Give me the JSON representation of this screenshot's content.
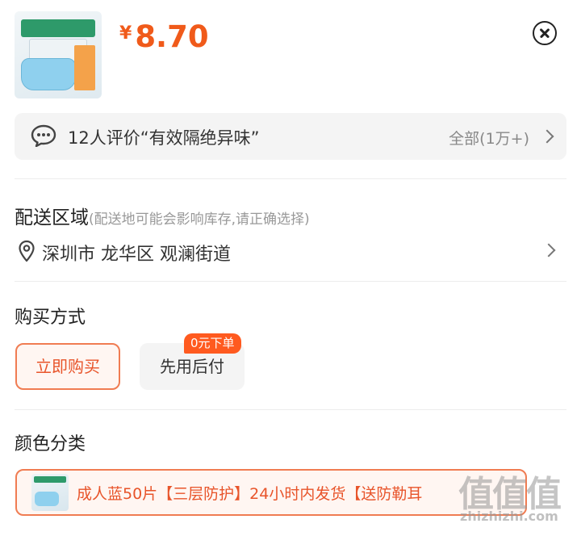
{
  "product": {
    "currency_symbol": "¥",
    "price": "8.70"
  },
  "reviews": {
    "summary": "12人评价“有效隔绝异味”",
    "all_link": "全部(1万+)"
  },
  "delivery": {
    "title": "配送区域",
    "hint": "(配送地可能会影响库存,请正确选择)",
    "address": "深圳市 龙华区 观澜街道"
  },
  "purchase_method": {
    "title": "购买方式",
    "options": [
      {
        "label": "立即购买",
        "selected": true
      },
      {
        "label": "先用后付",
        "selected": false,
        "badge": "0元下单"
      }
    ]
  },
  "color_category": {
    "title": "颜色分类",
    "selected_option": "成人蓝50片【三层防护】24小时内发货【送防勒耳"
  },
  "watermark": {
    "glyphs": "值值值",
    "url": "zhizhizhi.com"
  },
  "colors": {
    "accent": "#f05a1a",
    "selected_border": "#f07c52",
    "badge_bg": "#ff5a1f"
  }
}
